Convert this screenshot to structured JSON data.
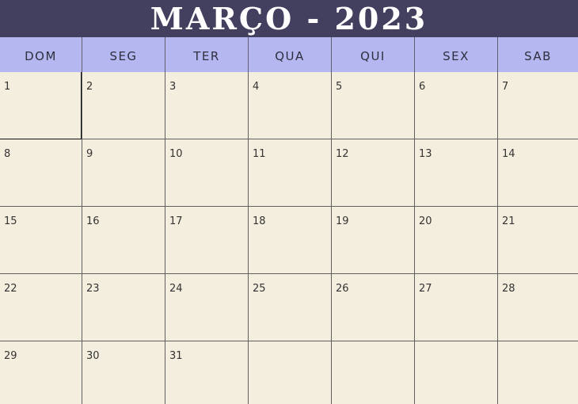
{
  "calendar": {
    "title": "MARÇO - 2023",
    "weekdays": [
      "DOM",
      "SEG",
      "TER",
      "QUA",
      "QUI",
      "SEX",
      "SAB"
    ],
    "days": [
      "1",
      "2",
      "3",
      "4",
      "5",
      "6",
      "7",
      "8",
      "9",
      "10",
      "11",
      "12",
      "13",
      "14",
      "15",
      "16",
      "17",
      "18",
      "19",
      "20",
      "21",
      "22",
      "23",
      "24",
      "25",
      "26",
      "27",
      "28",
      "29",
      "30",
      "31",
      "",
      "",
      "",
      ""
    ]
  },
  "colors": {
    "header_bg": "#423f5f",
    "weekday_bg": "#b4b7f0",
    "cell_bg": "#f3eede",
    "grid_line": "#5f5f5f"
  }
}
